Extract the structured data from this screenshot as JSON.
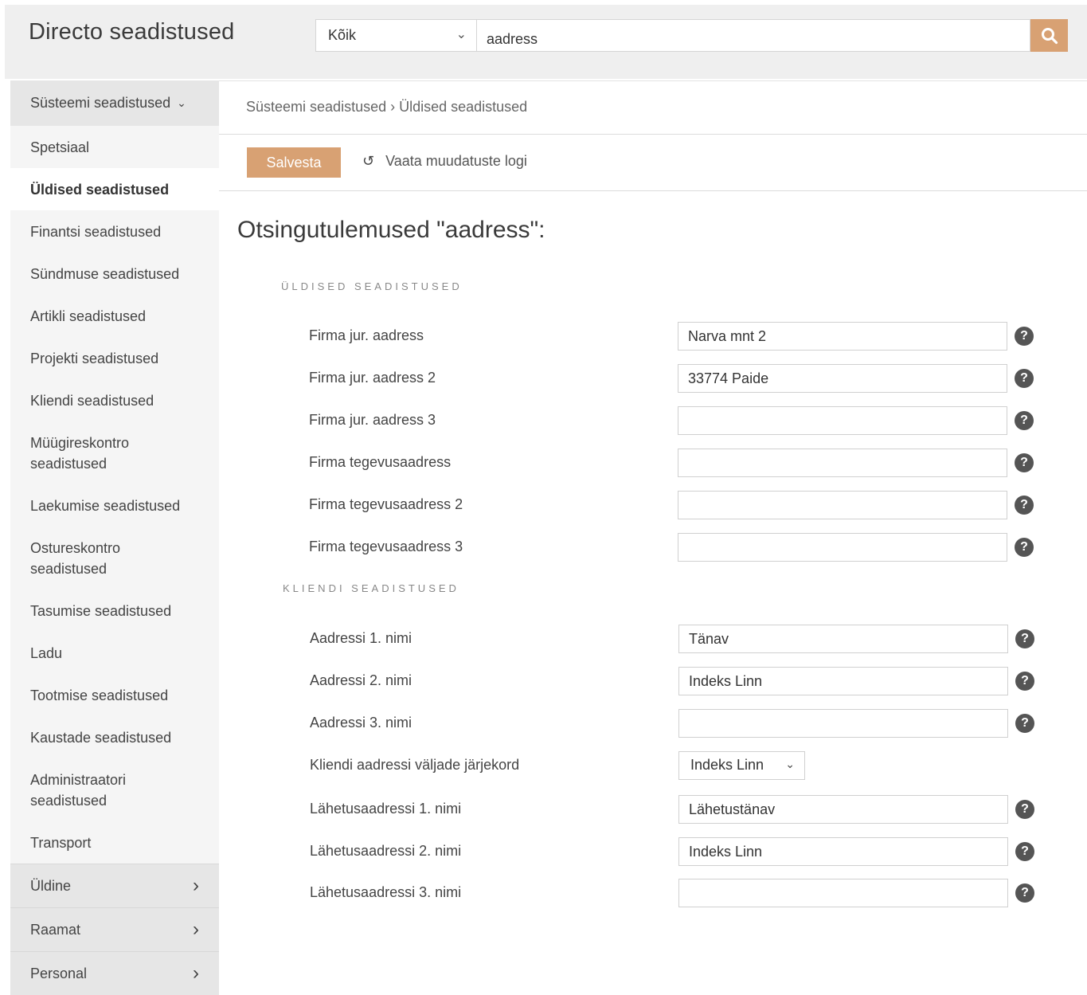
{
  "header": {
    "app_title": "Directo seadistused",
    "scope_select": "Kõik",
    "search_value": "aadress"
  },
  "sidebar": {
    "section_title": "Süsteemi seadistused",
    "items": [
      {
        "label": "Spetsiaal"
      },
      {
        "label": "Üldised seadistused",
        "active": true
      },
      {
        "label": "Finantsi seadistused"
      },
      {
        "label": "Sündmuse seadistused"
      },
      {
        "label": "Artikli seadistused"
      },
      {
        "label": "Projekti seadistused"
      },
      {
        "label": "Kliendi seadistused"
      },
      {
        "label": "Müügireskontro seadistused"
      },
      {
        "label": "Laekumise seadistused"
      },
      {
        "label": "Ostureskontro seadistused"
      },
      {
        "label": "Tasumise seadistused"
      },
      {
        "label": "Ladu"
      },
      {
        "label": "Tootmise seadistused"
      },
      {
        "label": "Kaustade seadistused"
      },
      {
        "label": "Administraatori seadistused"
      },
      {
        "label": "Transport"
      }
    ],
    "groups": [
      {
        "label": "Üldine"
      },
      {
        "label": "Raamat"
      },
      {
        "label": "Personal"
      }
    ]
  },
  "main": {
    "breadcrumb": "Süsteemi seadistused › Üldised seadistused",
    "save_label": "Salvesta",
    "log_label": "Vaata muudatuste logi",
    "results_title": "Otsingutulemused \"aadress\":",
    "sections": [
      {
        "title": "ÜLDISED SEADISTUSED",
        "rows": [
          {
            "label": "Firma jur. aadress",
            "value": "Narva mnt 2"
          },
          {
            "label": "Firma jur. aadress 2",
            "value": "33774 Paide"
          },
          {
            "label": "Firma jur. aadress 3",
            "value": ""
          },
          {
            "label": "Firma tegevusaadress",
            "value": ""
          },
          {
            "label": "Firma tegevusaadress 2",
            "value": ""
          },
          {
            "label": "Firma tegevusaadress 3",
            "value": ""
          }
        ]
      },
      {
        "title": "KLIENDI SEADISTUSED",
        "rows": [
          {
            "label": "Aadressi 1. nimi",
            "value": "Tänav"
          },
          {
            "label": "Aadressi 2. nimi",
            "value": "Indeks Linn"
          },
          {
            "label": "Aadressi 3. nimi",
            "value": ""
          },
          {
            "label": "Kliendi aadressi väljade järjekord",
            "value": "Indeks Linn",
            "type": "select"
          },
          {
            "label": "Lähetusaadressi 1. nimi",
            "value": "Lähetustänav"
          },
          {
            "label": "Lähetusaadressi 2. nimi",
            "value": "Indeks Linn"
          },
          {
            "label": "Lähetusaadressi 3. nimi",
            "value": ""
          }
        ]
      }
    ],
    "help_glyph": "?"
  },
  "colors": {
    "accent": "#d8a173",
    "header_bg": "#efefef",
    "sidebar_bg": "#f5f5f5",
    "sidebar_group_bg": "#e6e6e6"
  }
}
